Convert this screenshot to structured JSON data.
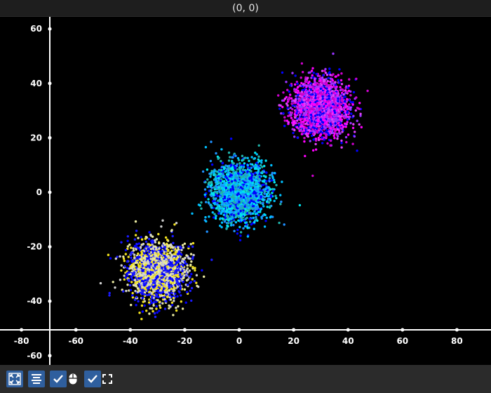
{
  "window": {
    "title": "(0, 0)"
  },
  "toolbar": {
    "buttons": [
      {
        "icon": "autoscale-icon",
        "checked": null
      },
      {
        "icon": "align-icon",
        "checked": null
      },
      {
        "icon": "checkbox-icon",
        "checked": true
      },
      {
        "icon": "mouse-icon",
        "checked": null
      },
      {
        "icon": "checkbox-icon",
        "checked": true
      },
      {
        "icon": "fullscreen-icon",
        "checked": null
      }
    ],
    "accent": "#2f5f9e"
  },
  "chart_data": {
    "type": "scatter",
    "title": "",
    "xlabel": "",
    "ylabel": "",
    "xlim": [
      -90,
      90
    ],
    "ylim": [
      -65,
      65
    ],
    "x_ticks": [
      -80,
      -60,
      -40,
      -20,
      0,
      20,
      40,
      60,
      80
    ],
    "y_ticks": [
      -60,
      -40,
      -20,
      0,
      20,
      40,
      60
    ],
    "x_tick_labels": [
      "-80",
      "-60",
      "-40",
      "-20",
      "0",
      "20",
      "40",
      "60",
      "80"
    ],
    "y_tick_labels": [
      "-60",
      "-40",
      "-20",
      "0",
      "20",
      "40",
      "60"
    ],
    "grid": false,
    "background": "#000000",
    "axis_color": "#ffffff",
    "clusters": [
      {
        "center": [
          -30,
          -29
        ],
        "spread": 5.2,
        "count": 2200,
        "colors": [
          "#1a1aff",
          "#e8e8a0",
          "#f0e020",
          "#d0d0d0",
          "#0000ff"
        ]
      },
      {
        "center": [
          0,
          0
        ],
        "spread": 5.2,
        "count": 2200,
        "colors": [
          "#0000ff",
          "#00bfff",
          "#1e90ff",
          "#00e5ee",
          "#20b2aa"
        ]
      },
      {
        "center": [
          30,
          31
        ],
        "spread": 5.2,
        "count": 2200,
        "colors": [
          "#0000ff",
          "#ff00ff",
          "#cc00cc",
          "#9933ff",
          "#e040fb"
        ]
      }
    ]
  }
}
